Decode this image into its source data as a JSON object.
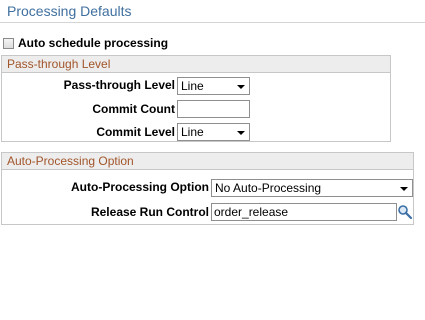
{
  "page": {
    "title": "Processing Defaults"
  },
  "auto_schedule": {
    "label": "Auto schedule processing",
    "checked": false
  },
  "passthrough_group": {
    "header": "Pass-through Level",
    "passthrough_level_label": "Pass-through Level",
    "passthrough_level_value": "Line",
    "commit_count_label": "Commit Count",
    "commit_count_value": "",
    "commit_level_label": "Commit Level",
    "commit_level_value": "Line"
  },
  "autoprocessing_group": {
    "header": "Auto-Processing Option",
    "autoprocessing_label": "Auto-Processing Option",
    "autoprocessing_value": "No Auto-Processing",
    "release_run_control_label": "Release Run Control",
    "release_run_control_value": "order_release"
  },
  "icons": {
    "lookup": "magnifier-lookup-icon",
    "dropdown": "chevron-down-icon",
    "checkbox": "checkbox-icon"
  },
  "colors": {
    "title": "#3f6f9f",
    "group_header_text": "#a1552a",
    "group_header_bg": "#ededed"
  }
}
